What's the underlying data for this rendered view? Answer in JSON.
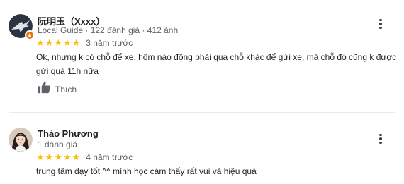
{
  "reviews": [
    {
      "author": "阮明玉（Xxxx）",
      "meta": "Local Guide · 122 đánh giá · 412 ảnh",
      "rating": 5,
      "time": "3 năm trước",
      "text": "Ok, nhưng k có chỗ để xe, hôm nào đông phải qua chỗ khác để gửi xe, mà chỗ đó cũng k được gửi quá 11h nữa",
      "like_label": "Thích",
      "avatar_icon": "eagle-avatar-icon",
      "badge_icon": "local-guide-star-icon",
      "badge_color": "#e8710a"
    },
    {
      "author": "Thảo Phương",
      "meta": "1 đánh giá",
      "rating": 5,
      "time": "4 năm trước",
      "text": "trung tâm dạy tốt ^^ mình học cảm thấy rất vui và hiệu quả",
      "avatar_icon": "profile-photo-avatar-icon"
    }
  ],
  "colors": {
    "star": "#fbbc04",
    "secondary_text": "#5f6368",
    "primary_text": "#202124",
    "divider": "#e8eaed"
  }
}
